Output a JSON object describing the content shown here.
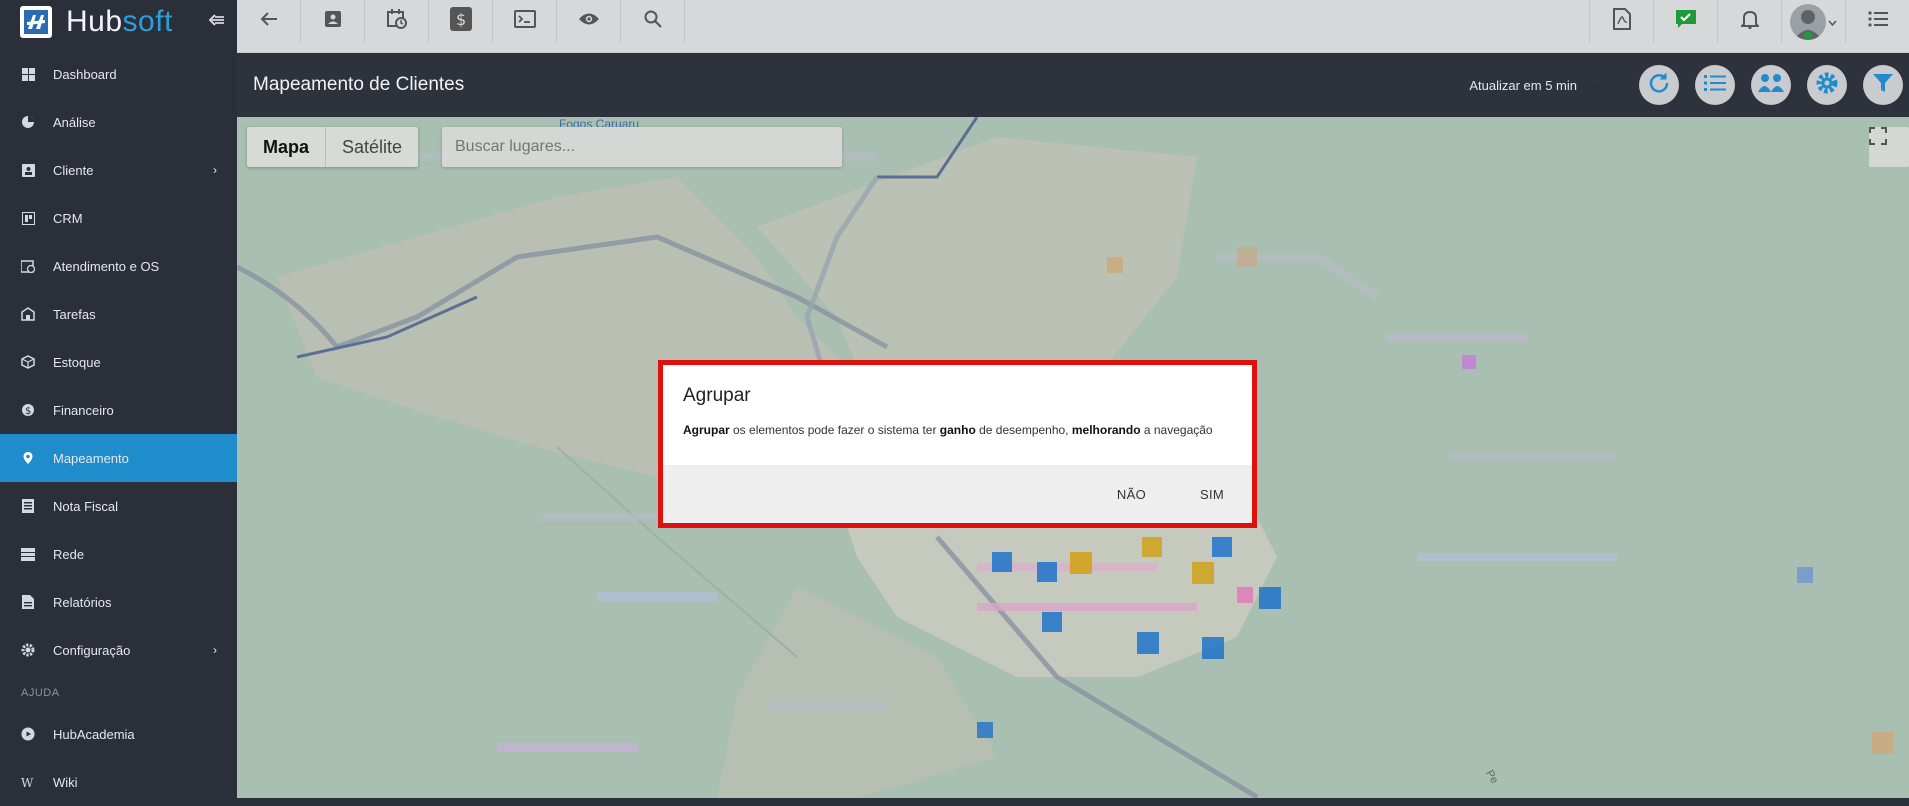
{
  "app": {
    "logo_hub": "Hub",
    "logo_soft": "soft"
  },
  "sidebar": {
    "items": [
      {
        "label": "Dashboard",
        "icon": "dashboard-icon"
      },
      {
        "label": "Análise",
        "icon": "pie-chart-icon"
      },
      {
        "label": "Cliente",
        "icon": "contact-card-icon",
        "has_submenu": true
      },
      {
        "label": "CRM",
        "icon": "kanban-icon"
      },
      {
        "label": "Atendimento e OS",
        "icon": "calendar-clock-icon"
      },
      {
        "label": "Tarefas",
        "icon": "tasks-icon"
      },
      {
        "label": "Estoque",
        "icon": "box-icon"
      },
      {
        "label": "Financeiro",
        "icon": "money-icon"
      },
      {
        "label": "Mapeamento",
        "icon": "map-pin-icon",
        "active": true
      },
      {
        "label": "Nota Fiscal",
        "icon": "invoice-icon"
      },
      {
        "label": "Rede",
        "icon": "network-icon"
      },
      {
        "label": "Relatórios",
        "icon": "report-icon"
      },
      {
        "label": "Configuração",
        "icon": "gear-icon",
        "has_submenu": true
      }
    ],
    "help_section": "AJUDA",
    "help_items": [
      {
        "label": "HubAcademia",
        "icon": "youtube-icon"
      },
      {
        "label": "Wiki",
        "icon": "wiki-icon"
      }
    ]
  },
  "topbar": {
    "left_icons": [
      "back-arrow-icon",
      "contact-card-icon",
      "calendar-clock-icon",
      "dollar-icon",
      "terminal-icon",
      "eye-icon",
      "search-icon"
    ],
    "right_icons": [
      "pdf-icon",
      "chat-check-icon",
      "bell-icon",
      "avatar",
      "menu-list-icon"
    ]
  },
  "header": {
    "title": "Mapeamento de Clientes",
    "refresh_label": "Atualizar em 5 min",
    "action_icons": [
      "refresh-icon",
      "list-icon",
      "group-icon",
      "settings-icon",
      "filter-icon"
    ]
  },
  "map": {
    "type_map": "Mapa",
    "type_satellite": "Satélite",
    "search_placeholder": "Buscar lugares...",
    "poi_label": "Fogos Caruaru",
    "road_label": "Pe",
    "colors": {
      "land": "#a9bfb1",
      "urban": "#c9c6bc",
      "marker_blue": "#1f73c9",
      "marker_yellow": "#d0a21c"
    }
  },
  "dialog": {
    "title": "Agrupar",
    "text_b1": "Agrupar",
    "text_1": " os elementos pode fazer o sistema ter ",
    "text_b2": "ganho",
    "text_2": " de desempenho, ",
    "text_b3": "melhorando",
    "text_3": " a navegação",
    "no_label": "NÃO",
    "yes_label": "SIM"
  }
}
